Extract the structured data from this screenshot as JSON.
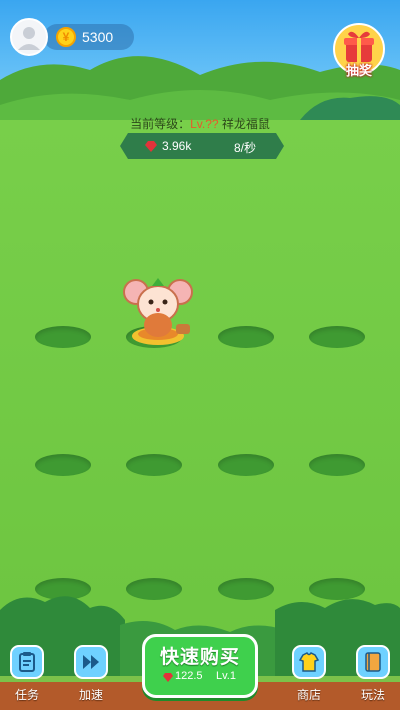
{
  "header": {
    "coins": "5300",
    "lottery_label": "抽奖"
  },
  "level": {
    "prefix": "当前等级：",
    "code": "Lv.??",
    "name": "祥龙福鼠"
  },
  "stats": {
    "gems": "3.96k",
    "rate": "8/秒"
  },
  "buy": {
    "title": "快速购买",
    "price": "122.5",
    "level": "Lv.1"
  },
  "nav": {
    "tasks": "任务",
    "speed": "加速",
    "shop": "商店",
    "rules": "玩法"
  },
  "colors": {
    "grass": "#78cf4a",
    "hole": "#3f9a32",
    "buy_button": "#3fd04d",
    "nav_button": "#6fd1ff",
    "bottom_bar": "#b35a2a"
  }
}
